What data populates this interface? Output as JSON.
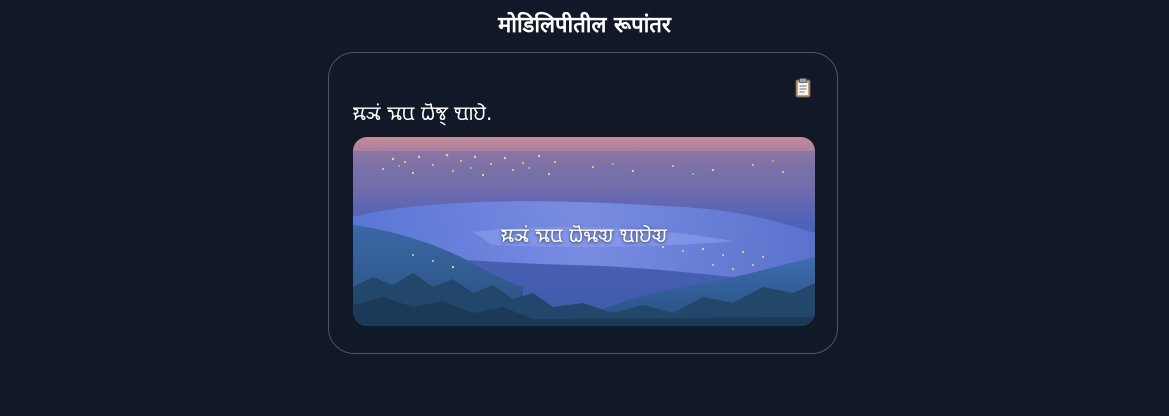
{
  "header": {
    "title": "मोडिलिपीतील रूपांतर"
  },
  "result": {
    "converted_text": "𑘦𑘰𑘗𑘽 𑘡𑘰𑘪 𑘢𑘺𑘕𑘿 𑘁𑘰𑘮𑘹.",
    "copy_icon": "clipboard-icon"
  },
  "image": {
    "caption": "𑘦𑘰𑘗𑘽 𑘡𑘰𑘪 𑘢𑘺𑘕𑘰𑘀 𑘁𑘰𑘮𑘹𑘀"
  }
}
